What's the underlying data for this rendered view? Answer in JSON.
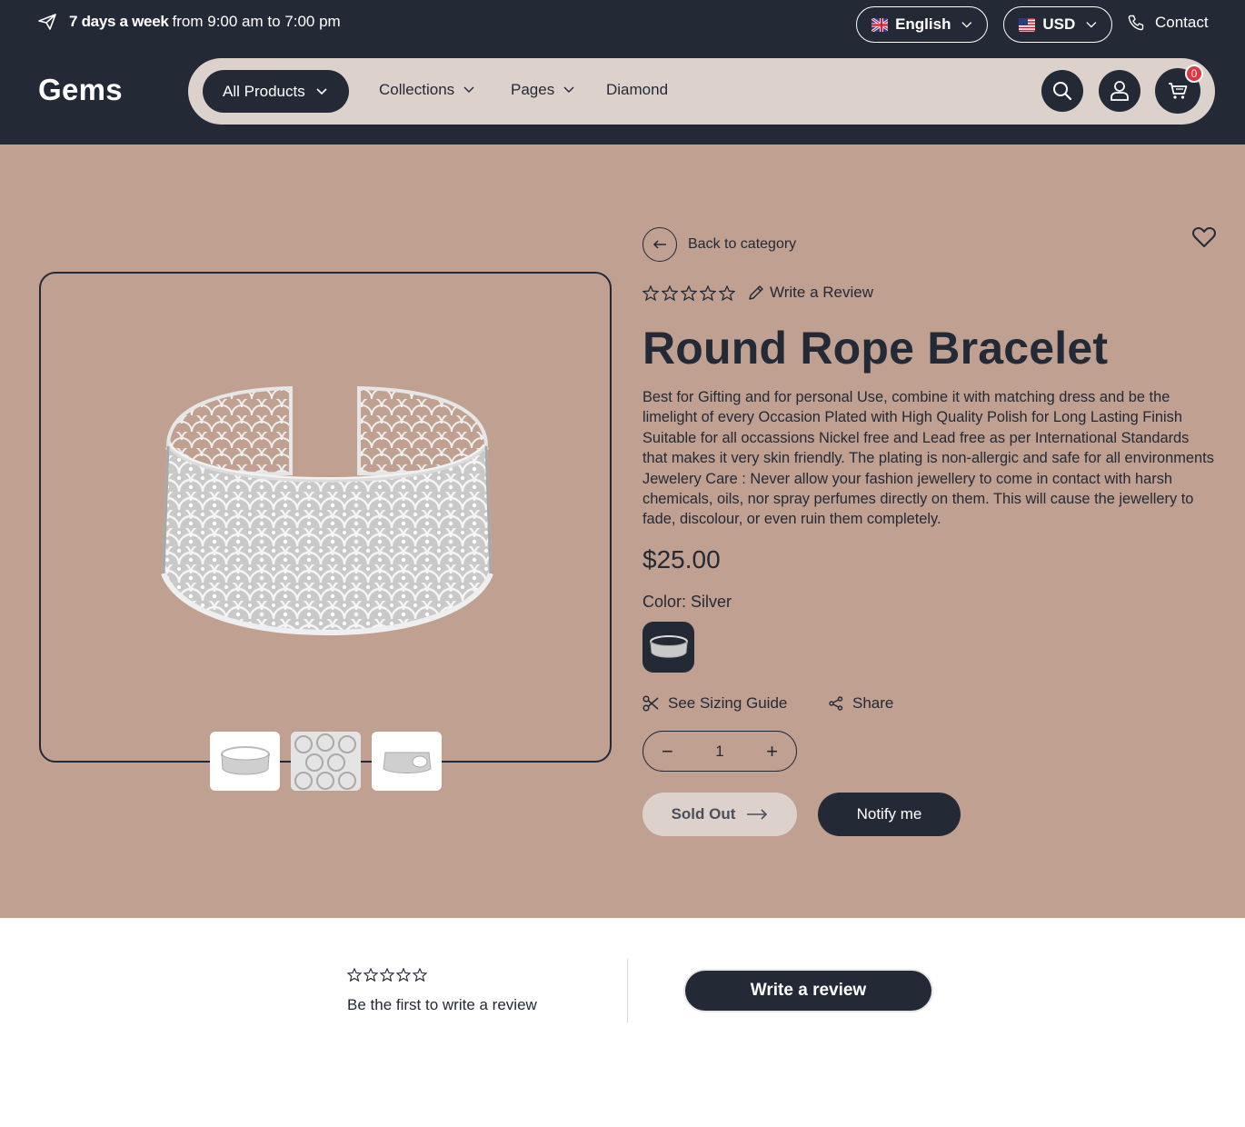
{
  "topbar": {
    "announce_bold": "7 days a week",
    "announce_rest": "from 9:00 am to 7:00 pm",
    "language": "English",
    "currency": "USD",
    "contact": "Contact"
  },
  "brand": {
    "logo": "Gems"
  },
  "nav": {
    "all_products": "All Products",
    "collections": "Collections",
    "pages": "Pages",
    "diamond": "Diamond",
    "cart_count": "0"
  },
  "product": {
    "back": "Back to category",
    "write_review": "Write a Review",
    "title": "Round Rope Bracelet",
    "description": "Best for Gifting and for personal Use, combine it with matching dress and be the limelight of every Occasion Plated with High Quality Polish for Long Lasting Finish Suitable for all occassions Nickel free and Lead free as per International Standards that makes it very skin friendly. The plating is non-allergic and safe for all environments Jewelery Care : Never allow your fashion jewellery to come in contact with harsh chemicals, oils, nor spray perfumes directly on them. This will cause the jewellery to fade, discolour, or even ruin them completely.",
    "price": "$25.00",
    "color_label": "Color: Silver",
    "sizing_guide": "See Sizing Guide",
    "share": "Share",
    "quantity": "1",
    "minus": "−",
    "plus": "+",
    "sold_out": "Sold Out",
    "notify": "Notify me",
    "rating": 0
  },
  "reviews": {
    "empty_text": "Be the first to write a review",
    "button": "Write a review"
  },
  "colors": {
    "navy": "#232a36",
    "product_bg": "#bfa091",
    "nav_bg": "#ddd2cb",
    "badge": "#e3343f"
  }
}
